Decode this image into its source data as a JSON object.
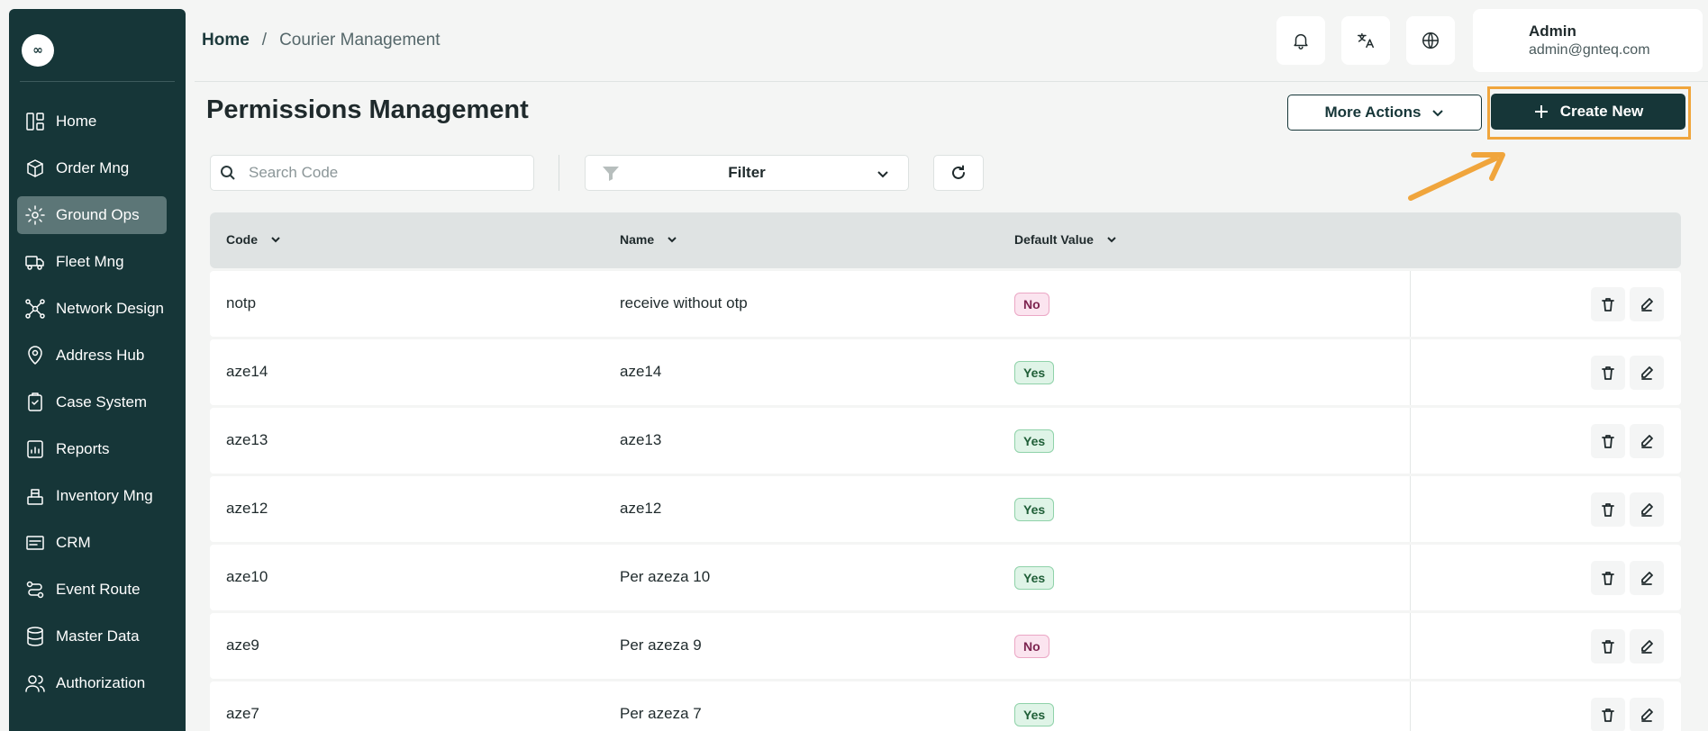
{
  "sidebar": {
    "logo_glyph": "∞",
    "items": [
      {
        "label": "Home",
        "icon": "layout-icon",
        "active": false
      },
      {
        "label": "Order Mng",
        "icon": "package-icon",
        "active": false
      },
      {
        "label": "Ground Ops",
        "icon": "gear-icon",
        "active": true
      },
      {
        "label": "Fleet Mng",
        "icon": "truck-icon",
        "active": false
      },
      {
        "label": "Network Design",
        "icon": "network-icon",
        "active": false
      },
      {
        "label": "Address Hub",
        "icon": "map-pin-icon",
        "active": false
      },
      {
        "label": "Case System",
        "icon": "clipboard-icon",
        "active": false
      },
      {
        "label": "Reports",
        "icon": "report-icon",
        "active": false
      },
      {
        "label": "Inventory Mng",
        "icon": "inventory-icon",
        "active": false
      },
      {
        "label": "CRM",
        "icon": "crm-icon",
        "active": false
      },
      {
        "label": "Event Route",
        "icon": "route-icon",
        "active": false
      },
      {
        "label": "Master Data",
        "icon": "database-icon",
        "active": false
      },
      {
        "label": "Authorization",
        "icon": "users-icon",
        "active": false
      }
    ]
  },
  "header": {
    "breadcrumb": {
      "home": "Home",
      "separator": "/",
      "current": "Courier Management"
    },
    "user": {
      "name": "Admin",
      "email": "admin@gnteq.com"
    }
  },
  "page": {
    "title": "Permissions Management",
    "more_actions_label": "More Actions",
    "create_new_label": "Create New",
    "search_placeholder": "Search Code",
    "filter_label": "Filter"
  },
  "table": {
    "columns": [
      "Code",
      "Name",
      "Default Value"
    ],
    "rows": [
      {
        "code": "notp",
        "name": "receive without otp",
        "default": "No"
      },
      {
        "code": "aze14",
        "name": "aze14",
        "default": "Yes"
      },
      {
        "code": "aze13",
        "name": "aze13",
        "default": "Yes"
      },
      {
        "code": "aze12",
        "name": "aze12",
        "default": "Yes"
      },
      {
        "code": "aze10",
        "name": "Per azeza 10",
        "default": "Yes"
      },
      {
        "code": "aze9",
        "name": "Per azeza 9",
        "default": "No"
      },
      {
        "code": "aze7",
        "name": "Per azeza 7",
        "default": "Yes"
      }
    ]
  },
  "colors": {
    "sidebar_bg": "#163638",
    "accent": "#163638",
    "highlight": "#f0a53c",
    "yes_badge": "#dff4e7",
    "no_badge": "#fbe4ef"
  }
}
